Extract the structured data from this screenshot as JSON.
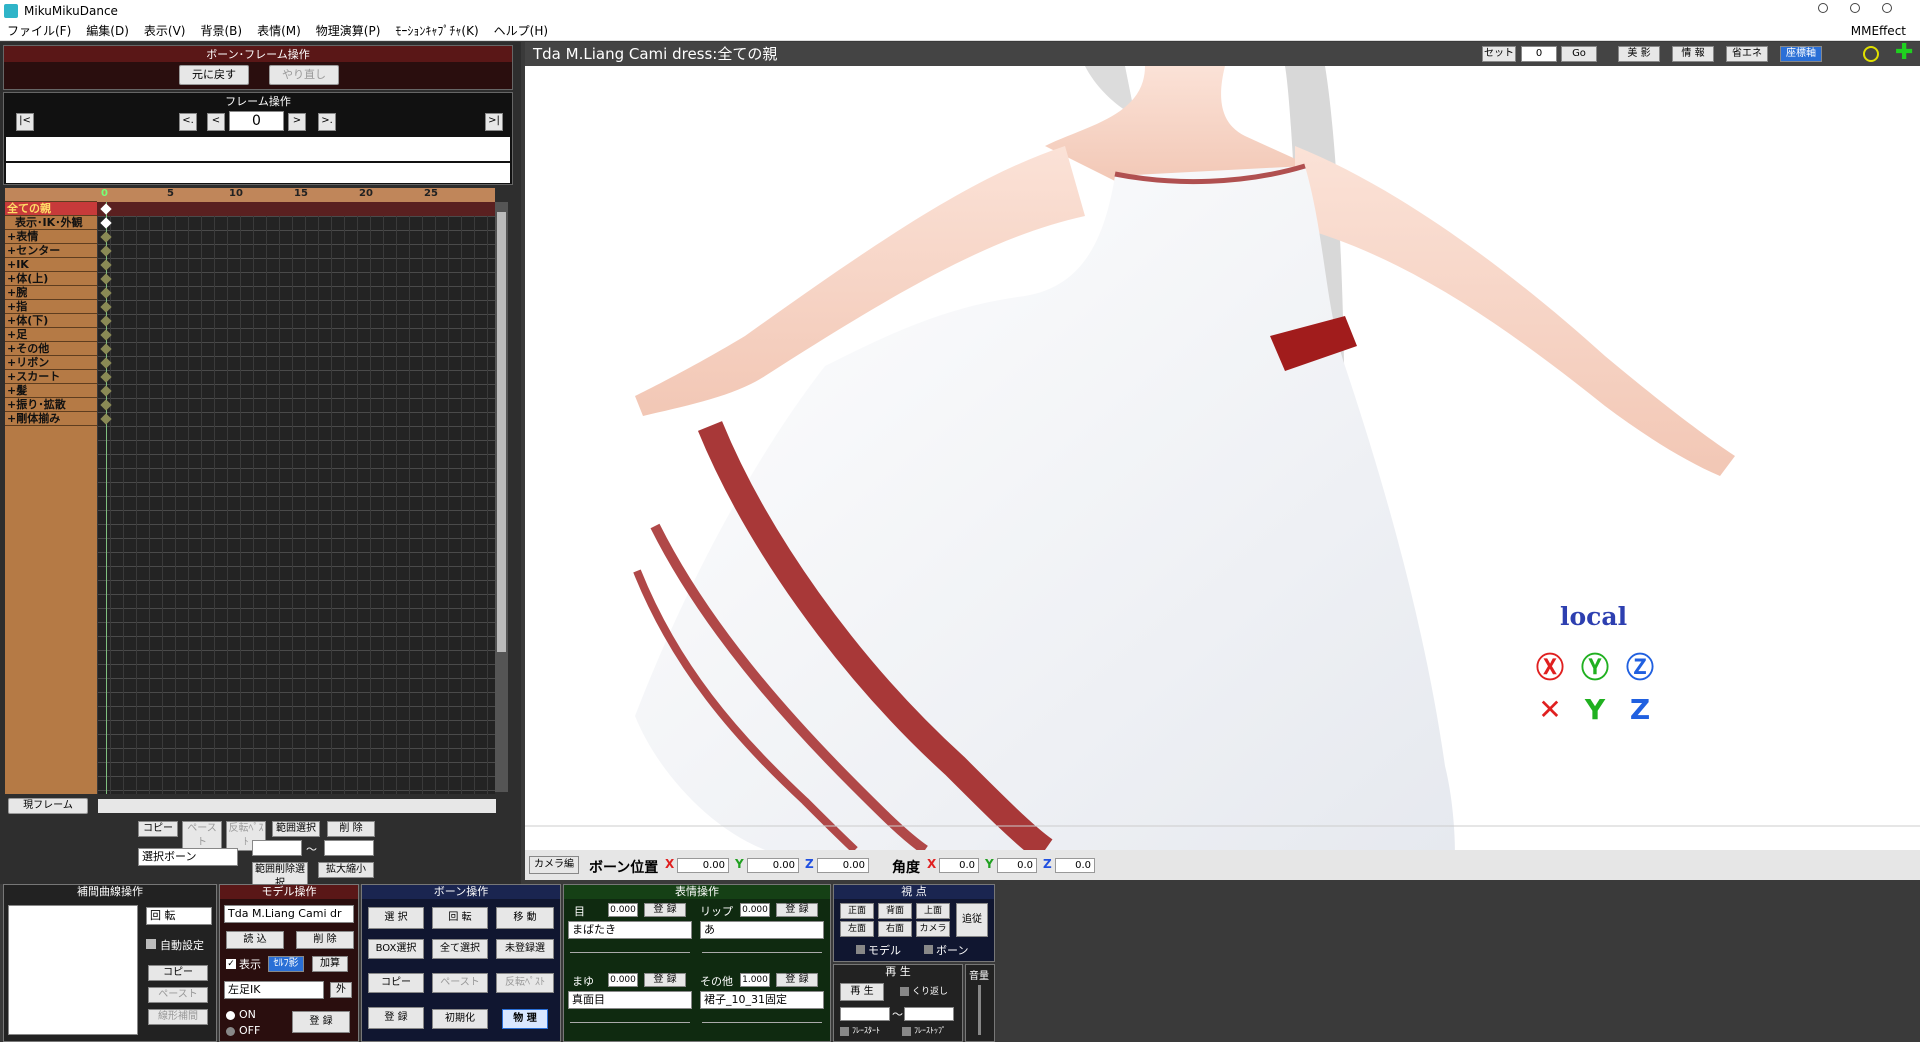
{
  "app": {
    "title": "MikuMikuDance"
  },
  "menu": {
    "items": [
      "ファイル(F)",
      "編集(D)",
      "表示(V)",
      "背景(B)",
      "表情(M)",
      "物理演算(P)",
      "ﾓｰｼｮﾝｷｬﾌﾟﾁｬ(K)",
      "ヘルプ(H)"
    ],
    "right": "MMEffect"
  },
  "bone_frame": {
    "title": "ボーン･フレーム操作",
    "undo": "元に戻す",
    "redo": "やり直し"
  },
  "frame_op": {
    "title": "フレーム操作",
    "first": "|<",
    "prev_key": "<.",
    "prev": "<",
    "frame_value": "0",
    "next": ">",
    "next_key": ">.",
    "last": ">|"
  },
  "timeline": {
    "ruler": [
      "0",
      "5",
      "10",
      "15",
      "20",
      "25"
    ],
    "rows": [
      "全ての親",
      "表示･IK･外観",
      "+表情",
      "+センター",
      "+IK",
      "+体(上)",
      "+腕",
      "+指",
      "+体(下)",
      "+足",
      "+その他",
      "+リボン",
      "+スカート",
      "+髪",
      "+振り･拡散",
      "+剛体揃み"
    ],
    "range_button": "現フレーム"
  },
  "timeline_tools": {
    "copy": "コピー",
    "paste": "ペースト",
    "reverse_paste": "反転ﾍﾟｽﾄ",
    "range_select": "範囲選択",
    "delete": "削 除",
    "select_bone": "選択ボーン",
    "tilde": "～",
    "delete_select": "範囲削除選択",
    "expand": "拡大縮小"
  },
  "viewport": {
    "title": "Tda M.Liang Cami dress:全ての親",
    "set_label": "セット",
    "frame": "0",
    "go": "Go",
    "btns": [
      "美 影",
      "情 報",
      "省エネ",
      "座標軸"
    ],
    "local": "local"
  },
  "bone_position": {
    "camera_tab": "カメラ編",
    "pos_label": "ボーン位置",
    "x": "0.00",
    "y": "0.00",
    "z": "0.00",
    "angle_label": "角度",
    "ax": "0.0",
    "ay": "0.0",
    "az": "0.0"
  },
  "interp": {
    "title": "補間曲線操作",
    "mode": "回 転",
    "auto": "自動設定",
    "copy": "コピー",
    "paste": "ペースト",
    "linear": "線形補間"
  },
  "model_op": {
    "title": "モデル操作",
    "model": "Tda M.Liang Cami dr",
    "load": "読 込",
    "delete": "削 除",
    "show": "表示",
    "alpha": "ｾﾙﾌ影",
    "add": "加算",
    "ik": "左足IK",
    "outer": "外",
    "on": "ON",
    "off": "OFF",
    "register": "登 録"
  },
  "bone_op": {
    "title": "ボーン操作",
    "select": "選 択",
    "rotate": "回 転",
    "move": "移 動",
    "box": "BOX選択",
    "all": "全て選択",
    "unregistered": "未登録選",
    "copy": "コピー",
    "paste": "ペースト",
    "reverse": "反転ﾍﾟｽﾄ",
    "register": "登 録",
    "init": "初期化",
    "physics": "物 理"
  },
  "facial": {
    "title": "表情操作",
    "eye": "目",
    "eye_val": "0.000",
    "eye_sel": "まばたき",
    "lip": "リップ",
    "lip_val": "0.000",
    "lip_sel": "あ",
    "brow": "まゆ",
    "brow_val": "0.000",
    "brow_sel": "真面目",
    "other": "その他",
    "other_val": "1.000",
    "other_sel": "裙子_10_31固定",
    "reg": "登 録"
  },
  "view_point": {
    "title": "視 点",
    "front": "正面",
    "back": "背面",
    "top": "上面",
    "left": "左面",
    "right": "右面",
    "camera": "カメラ",
    "follow": "追従",
    "model": "モデル",
    "bone": "ボーン"
  },
  "playback": {
    "title": "再 生",
    "play": "再 生",
    "repeat": "くり返し",
    "tilde": "～",
    "fstart": "ﾌﾚｰｽﾀｰﾄ",
    "fstop": "ﾌﾚｰｽﾄｯﾌﾟ",
    "volume": "音量"
  }
}
